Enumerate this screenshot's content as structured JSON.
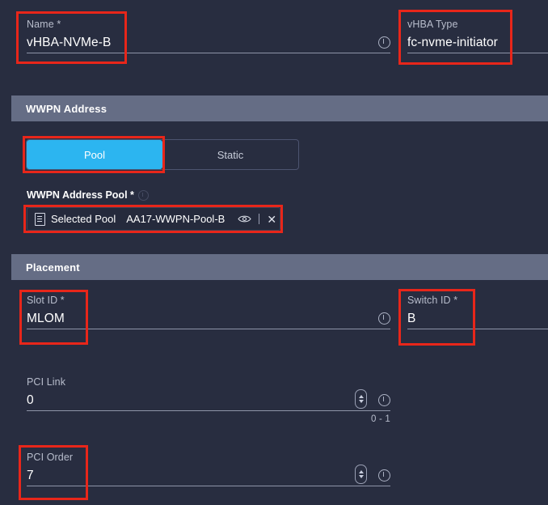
{
  "form": {
    "name_field": {
      "label": "Name *",
      "value": "vHBA-NVMe-B",
      "info_icon": "info-icon"
    },
    "vhba_type_field": {
      "label": "vHBA Type",
      "value": "fc-nvme-initiator"
    },
    "wwpn_section": {
      "title": "WWPN Address",
      "toggle": {
        "options": [
          "Pool",
          "Static"
        ],
        "selected": "Pool",
        "active_color": "#2cb5f0"
      },
      "pool_label": "WWPN Address Pool *",
      "selected_pool_text": "Selected Pool",
      "selected_pool_name": "AA17-WWPN-Pool-B",
      "view_icon": "eye-icon",
      "clear_icon": "close-icon",
      "doc_icon": "document-icon"
    },
    "placement_section": {
      "title": "Placement",
      "slot_id": {
        "label": "Slot ID *",
        "value": "MLOM"
      },
      "switch_id": {
        "label": "Switch ID *",
        "value": "B"
      },
      "pci_link": {
        "label": "PCI Link",
        "value": "0",
        "range_hint": "0 - 1",
        "stepper_icon": "stepper-icon"
      },
      "pci_order": {
        "label": "PCI Order",
        "value": "7",
        "stepper_icon": "stepper-icon"
      }
    }
  },
  "annotations": {
    "color": "#e8261a",
    "boxes": [
      "name-field-highlight",
      "vhba-type-highlight",
      "pool-toggle-highlight",
      "selected-pool-highlight",
      "slot-id-highlight",
      "switch-id-highlight",
      "pci-order-highlight"
    ]
  },
  "theme": {
    "background": "#282d40",
    "section_header_bg": "#656d85",
    "accent": "#2cb5f0",
    "text": "#ffffff",
    "muted_text": "#b8bdcc"
  }
}
